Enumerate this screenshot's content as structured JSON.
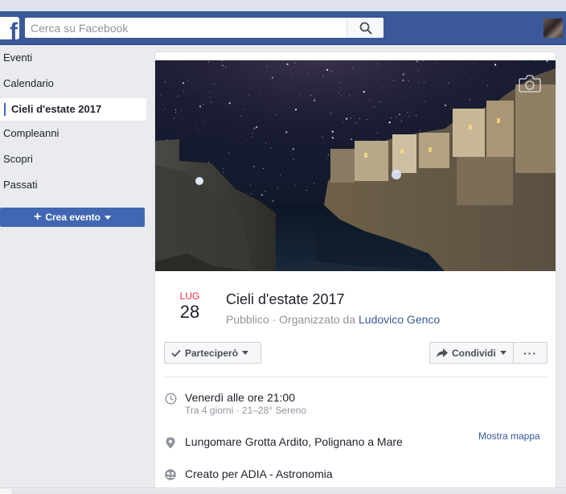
{
  "header": {
    "logo_letter": "f",
    "search_placeholder": "Cerca su Facebook"
  },
  "sidebar": {
    "items": [
      {
        "label": "Eventi"
      },
      {
        "label": "Calendario"
      },
      {
        "label": "Cieli d'estate 2017",
        "active": true
      },
      {
        "label": "Compleanni"
      },
      {
        "label": "Scopri"
      },
      {
        "label": "Passati"
      }
    ],
    "create_button": "Crea evento"
  },
  "event": {
    "month": "LUG",
    "day": "28",
    "title": "Cieli d'estate 2017",
    "privacy": "Pubblico",
    "separator": " · ",
    "organized_by": "Organizzato da ",
    "organizer": "Ludovico Genco",
    "going_button": "Parteciperò",
    "share_button": "Condividi",
    "more_button": "···",
    "time": "Venerdì alle ore 21:00",
    "time_detail": "Tra 4 giorni · 21–28° Sereno",
    "location": "Lungomare Grotta Ardito, Polignano a Mare",
    "map_link": "Mostra mappa",
    "created_for": "Creato per ADIA - Astronomia"
  },
  "colors": {
    "brand_blue": "#3b5998",
    "button_blue": "#4267b2",
    "month_red": "#f02849",
    "link_blue": "#365899"
  },
  "icons": [
    "search-icon",
    "camera-icon",
    "check-icon",
    "share-arrow-icon",
    "clock-icon",
    "location-pin-icon",
    "group-icon",
    "plus-icon"
  ]
}
